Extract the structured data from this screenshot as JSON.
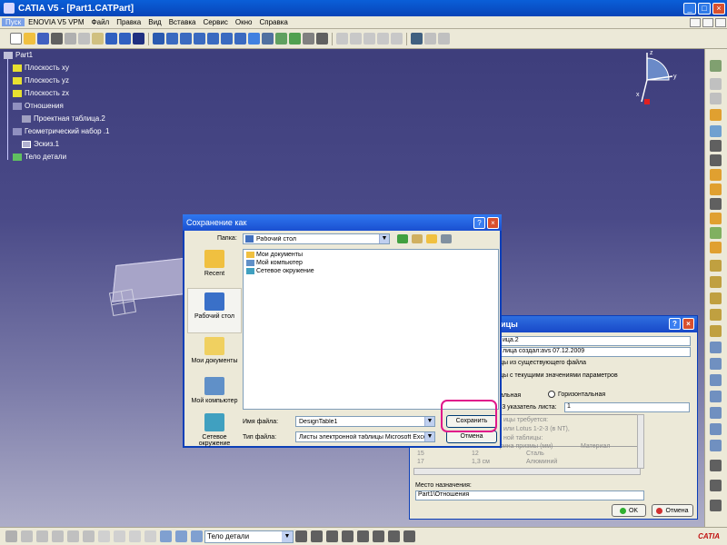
{
  "window": {
    "title": "CATIA V5 - [Part1.CATPart]",
    "min": "_",
    "max": "□",
    "close": "×"
  },
  "menu": {
    "items": [
      "Пуск",
      "ENOVIA V5 VPM",
      "Файл",
      "Правка",
      "Вид",
      "Вставка",
      "Сервис",
      "Окно",
      "Справка"
    ]
  },
  "tree": {
    "root": "Part1",
    "plane_xy": "Плоскость xy",
    "plane_yz": "Плоскость yz",
    "plane_zx": "Плоскость zx",
    "relations": "Отношения",
    "design_table": "Проектная таблица.2",
    "geo_set": "Геометрический набор .1",
    "sketch": "Эскиз.1",
    "body": "Тело детали"
  },
  "design_table_dialog": {
    "title": "ицы",
    "name_value": "ица.2",
    "comment_value": "лица создал:avs 07.12.2009",
    "opt_existing": "цы из существующего файла",
    "opt_current": "цы с текущими значениями параметров",
    "orient_vertical": "альная",
    "orient_horizontal": "Горизонтальная",
    "sheet_label": "-3 указатель листа:",
    "sheet_value": "1",
    "info_line1": "ицы требуется:",
    "info_line2": "или Lotus 1-2-3 (в NT),",
    "info_line3": "ной таблицы:",
    "col_width": "рина призмы (мм)",
    "col_material": "Материал",
    "r1_a": "15",
    "r1_b": "12",
    "r1_c": "Сталь",
    "r2_a": "17",
    "r2_b": "1,3 см",
    "r2_c": "Алюминий",
    "dest_label": "Место назначения:",
    "dest_value": "Part1\\Отношения",
    "ok": "OK",
    "cancel": "Отмена"
  },
  "save_dialog": {
    "title": "Сохранение как",
    "help": "?",
    "close": "×",
    "folder_label": "Папка:",
    "folder_value": "Рабочий стол",
    "places": [
      "Recent",
      "Рабочий стол",
      "Мои документы",
      "Мой компьютер",
      "Сетевое окружение"
    ],
    "files": [
      "Мои документы",
      "Мой компьютер",
      "Сетевое окружение"
    ],
    "filename_label": "Имя файла:",
    "filename_value": "DesignTable1",
    "filetype_label": "Тип файла:",
    "filetype_value": "Листы электронной таблицы Microsoft Excel",
    "save_button": "Сохранить",
    "cancel_button": "Отмена"
  },
  "bottom_toolbar": {
    "current_body": "Тело детали"
  },
  "compass": {
    "x": "x",
    "y": "y",
    "z": "z"
  },
  "logo": {
    "text": "CATIA"
  }
}
